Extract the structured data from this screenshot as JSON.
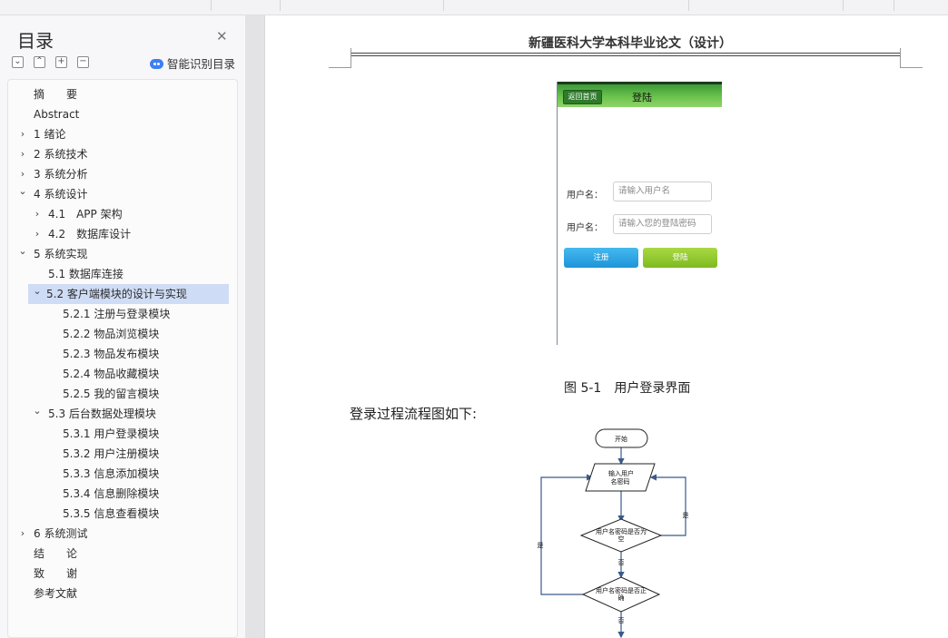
{
  "toc": {
    "title": "目录",
    "smart_label": "智能识别目录",
    "items": [
      {
        "label": "摘　　要",
        "level": 0,
        "expand": "none"
      },
      {
        "label": "Abstract",
        "level": 0,
        "expand": "none"
      },
      {
        "label": "1 绪论",
        "level": 0,
        "expand": "collapsed"
      },
      {
        "label": "2 系统技术",
        "level": 0,
        "expand": "collapsed"
      },
      {
        "label": "3 系统分析",
        "level": 0,
        "expand": "collapsed"
      },
      {
        "label": "4 系统设计",
        "level": 0,
        "expand": "expanded"
      },
      {
        "label": "4.1　APP 架构",
        "level": 1,
        "expand": "collapsed"
      },
      {
        "label": "4.2　数据库设计",
        "level": 1,
        "expand": "collapsed"
      },
      {
        "label": "5 系统实现",
        "level": 0,
        "expand": "expanded"
      },
      {
        "label": "5.1  数据库连接",
        "level": 1,
        "expand": "none"
      },
      {
        "label": "5.2 客户端模块的设计与实现",
        "level": 1,
        "expand": "expanded",
        "selected": true
      },
      {
        "label": "5.2.1  注册与登录模块",
        "level": 2,
        "expand": "none"
      },
      {
        "label": "5.2.2  物品浏览模块",
        "level": 2,
        "expand": "none"
      },
      {
        "label": "5.2.3  物品发布模块",
        "level": 2,
        "expand": "none"
      },
      {
        "label": "5.2.4  物品收藏模块",
        "level": 2,
        "expand": "none"
      },
      {
        "label": "5.2.5  我的留言模块",
        "level": 2,
        "expand": "none"
      },
      {
        "label": "5.3 后台数据处理模块",
        "level": 1,
        "expand": "expanded"
      },
      {
        "label": "5.3.1  用户登录模块",
        "level": 2,
        "expand": "none"
      },
      {
        "label": "5.3.2  用户注册模块",
        "level": 2,
        "expand": "none"
      },
      {
        "label": "5.3.3  信息添加模块",
        "level": 2,
        "expand": "none"
      },
      {
        "label": "5.3.4  信息删除模块",
        "level": 2,
        "expand": "none"
      },
      {
        "label": "5.3.5  信息查看模块",
        "level": 2,
        "expand": "none"
      },
      {
        "label": "6 系统测试",
        "level": 0,
        "expand": "collapsed"
      },
      {
        "label": "结　　论",
        "level": 0,
        "expand": "none"
      },
      {
        "label": "致　　谢",
        "level": 0,
        "expand": "none"
      },
      {
        "label": "参考文献",
        "level": 0,
        "expand": "none"
      }
    ]
  },
  "document": {
    "running_header": "新疆医科大学本科毕业论文（设计）",
    "phone_mock": {
      "back_button": "返回首页",
      "title": "登陆",
      "username_label": "用户名：",
      "username_placeholder": "请输入用户名",
      "password_label": "用户名：",
      "password_placeholder": "请输入您的登陆密码",
      "register_button": "注册",
      "login_button": "登陆"
    },
    "figure_caption": "图 5-1　用户登录界面",
    "flow_intro": "登录过程流程图如下:",
    "flowchart": {
      "start": "开始",
      "input_line1": "输入用户",
      "input_line2": "名密码",
      "check_empty_line1": "用户名密码是否为",
      "check_empty_line2": "空",
      "check_correct_line1": "用户名密码是否正",
      "check_correct_line2": "确",
      "yes": "是",
      "no": "否"
    }
  }
}
